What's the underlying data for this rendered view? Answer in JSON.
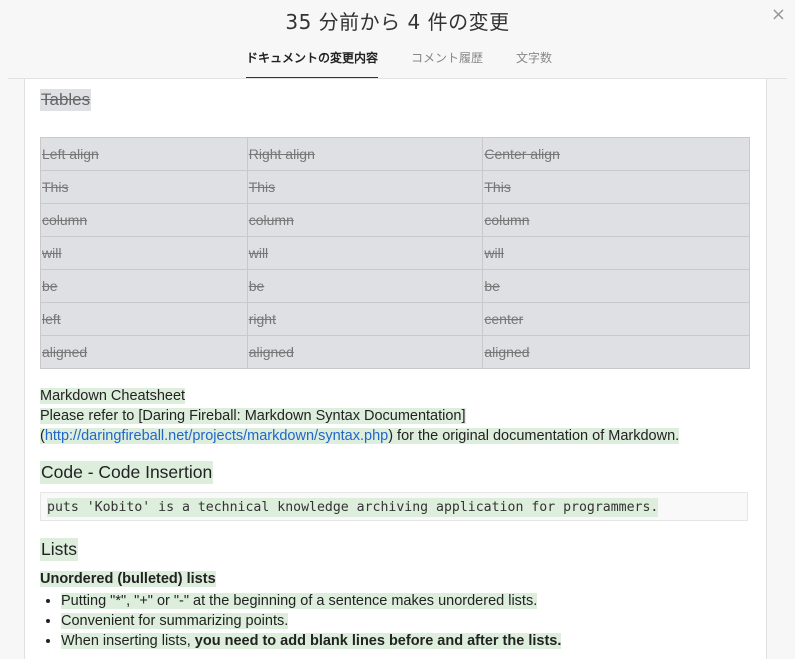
{
  "header": {
    "title": "35 分前から 4 件の変更",
    "close_label": "×",
    "tabs": [
      {
        "label": "ドキュメントの変更内容",
        "active": true
      },
      {
        "label": "コメント履歴",
        "active": false
      },
      {
        "label": "文字数",
        "active": false
      }
    ]
  },
  "document": {
    "deleted_heading": "Tables",
    "deleted_table": {
      "headers": [
        "Left align",
        "Right align",
        "Center align"
      ],
      "rows": [
        [
          "This",
          "This",
          "This"
        ],
        [
          "column",
          "column",
          "column"
        ],
        [
          "will",
          "will",
          "will"
        ],
        [
          "be",
          "be",
          "be"
        ],
        [
          "left",
          "right",
          "center"
        ],
        [
          "aligned",
          "aligned",
          "aligned"
        ]
      ]
    },
    "cheatsheet": {
      "title": "Markdown Cheatsheet",
      "line2": "Please refer to [Daring Fireball: Markdown Syntax Documentation]",
      "paren_open": "(",
      "link": "http://daringfireball.net/projects/markdown/syntax.php",
      "line3_rest": ") for the original documentation of Markdown."
    },
    "code_section": {
      "heading": "Code - Code Insertion",
      "code_part1": "puts 'Kobito'",
      "code_part2": " is a technical knowledge archiving application for programmers."
    },
    "lists_section": {
      "heading": "Lists",
      "subheading": "Unordered (bulleted) lists",
      "items": [
        {
          "text": "Putting \"*\", \"+\" or \"-\" at the beginning of a sentence makes unordered lists."
        },
        {
          "text": "Convenient for summarizing points."
        },
        {
          "text": "When inserting lists, ",
          "bold": "you need to add blank lines before and after the lists."
        }
      ]
    }
  }
}
